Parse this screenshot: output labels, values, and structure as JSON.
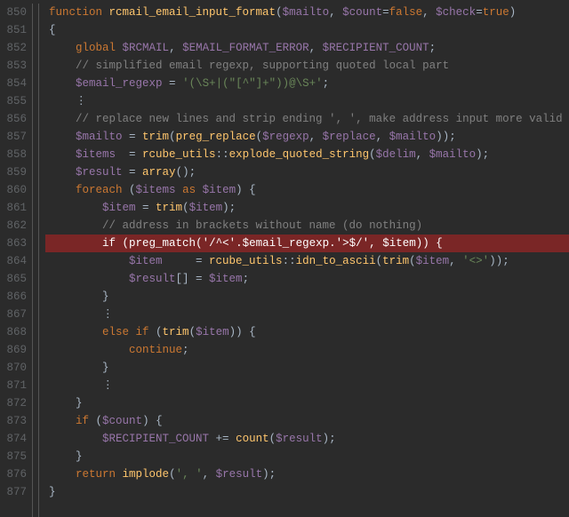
{
  "gutter": {
    "start": 850,
    "end": 877
  },
  "code": {
    "l850": {
      "t0": "function",
      "t1": " ",
      "t2": "rcmail_email_input_format",
      "t3": "(",
      "t4": "$mailto",
      "t5": ", ",
      "t6": "$count",
      "t7": "=",
      "t8": "false",
      "t9": ", ",
      "t10": "$check",
      "t11": "=",
      "t12": "true",
      "t13": ")"
    },
    "l851": {
      "t0": "{"
    },
    "l852": {
      "ind": "    ",
      "t0": "global",
      "t1": " ",
      "t2": "$RCMAIL",
      "t3": ", ",
      "t4": "$EMAIL_FORMAT_ERROR",
      "t5": ", ",
      "t6": "$RECIPIENT_COUNT",
      "t7": ";"
    },
    "l853": {
      "ind": "    ",
      "t0": "// simplified email regexp, supporting quoted local part"
    },
    "l854": {
      "ind": "    ",
      "t0": "$email_regexp",
      "t1": " = ",
      "t2": "'(\\S+|(\"[^\"]+\"))@\\S+'",
      "t3": ";"
    },
    "l855": {
      "ind": "    ",
      "t0": "⋮"
    },
    "l856": {
      "ind": "    ",
      "t0": "// replace new lines and strip ending ', ', make address input more valid"
    },
    "l857": {
      "ind": "    ",
      "t0": "$mailto",
      "t1": " = ",
      "t2": "trim",
      "t3": "(",
      "t4": "preg_replace",
      "t5": "(",
      "t6": "$regexp",
      "t7": ", ",
      "t8": "$replace",
      "t9": ", ",
      "t10": "$mailto",
      "t11": "));"
    },
    "l858": {
      "ind": "    ",
      "t0": "$items",
      "t1": "  = ",
      "t2": "rcube_utils",
      "t3": "::",
      "t4": "explode_quoted_string",
      "t5": "(",
      "t6": "$delim",
      "t7": ", ",
      "t8": "$mailto",
      "t9": ");"
    },
    "l859": {
      "ind": "    ",
      "t0": "$result",
      "t1": " = ",
      "t2": "array",
      "t3": "();"
    },
    "l860": {
      "ind": "    ",
      "t0": "foreach",
      "t1": " (",
      "t2": "$items",
      "t3": " ",
      "t4": "as",
      "t5": " ",
      "t6": "$item",
      "t7": ") {"
    },
    "l861": {
      "ind": "        ",
      "t0": "$item",
      "t1": " = ",
      "t2": "trim",
      "t3": "(",
      "t4": "$item",
      "t5": ");"
    },
    "l862": {
      "ind": "        ",
      "t0": "// address in brackets without name (do nothing)"
    },
    "l863": {
      "ind": "        ",
      "t0": "if",
      "t1": " (",
      "t2": "preg_match",
      "t3": "(",
      "t4": "'/^<'",
      "t5": ".",
      "t6": "$email_regexp",
      "t7": ".",
      "t8": "'>$/'",
      "t9": ", ",
      "t10": "$item",
      "t11": ")) {"
    },
    "l864": {
      "ind": "            ",
      "t0": "$item",
      "t1": "     = ",
      "t2": "rcube_utils",
      "t3": "::",
      "t4": "idn_to_ascii",
      "t5": "(",
      "t6": "trim",
      "t7": "(",
      "t8": "$item",
      "t9": ", ",
      "t10": "'<>'",
      "t11": "));"
    },
    "l865": {
      "ind": "            ",
      "t0": "$result",
      "t1": "[] = ",
      "t2": "$item",
      "t3": ";"
    },
    "l866": {
      "ind": "        ",
      "t0": "}"
    },
    "l867": {
      "ind": "        ",
      "t0": "⋮"
    },
    "l868": {
      "ind": "        ",
      "t0": "else if",
      "t1": " (",
      "t2": "trim",
      "t3": "(",
      "t4": "$item",
      "t5": ")) {"
    },
    "l869": {
      "ind": "            ",
      "t0": "continue",
      "t1": ";"
    },
    "l870": {
      "ind": "        ",
      "t0": "}"
    },
    "l871": {
      "ind": "        ",
      "t0": "⋮"
    },
    "l872": {
      "ind": "    ",
      "t0": "}"
    },
    "l873": {
      "ind": "    ",
      "t0": "if",
      "t1": " (",
      "t2": "$count",
      "t3": ") {"
    },
    "l874": {
      "ind": "        ",
      "t0": "$RECIPIENT_COUNT",
      "t1": " += ",
      "t2": "count",
      "t3": "(",
      "t4": "$result",
      "t5": ");"
    },
    "l875": {
      "ind": "    ",
      "t0": "}"
    },
    "l876": {
      "ind": "    ",
      "t0": "return",
      "t1": " ",
      "t2": "implode",
      "t3": "(",
      "t4": "', '",
      "t5": ", ",
      "t6": "$result",
      "t7": ");"
    },
    "l877": {
      "t0": "}"
    }
  }
}
